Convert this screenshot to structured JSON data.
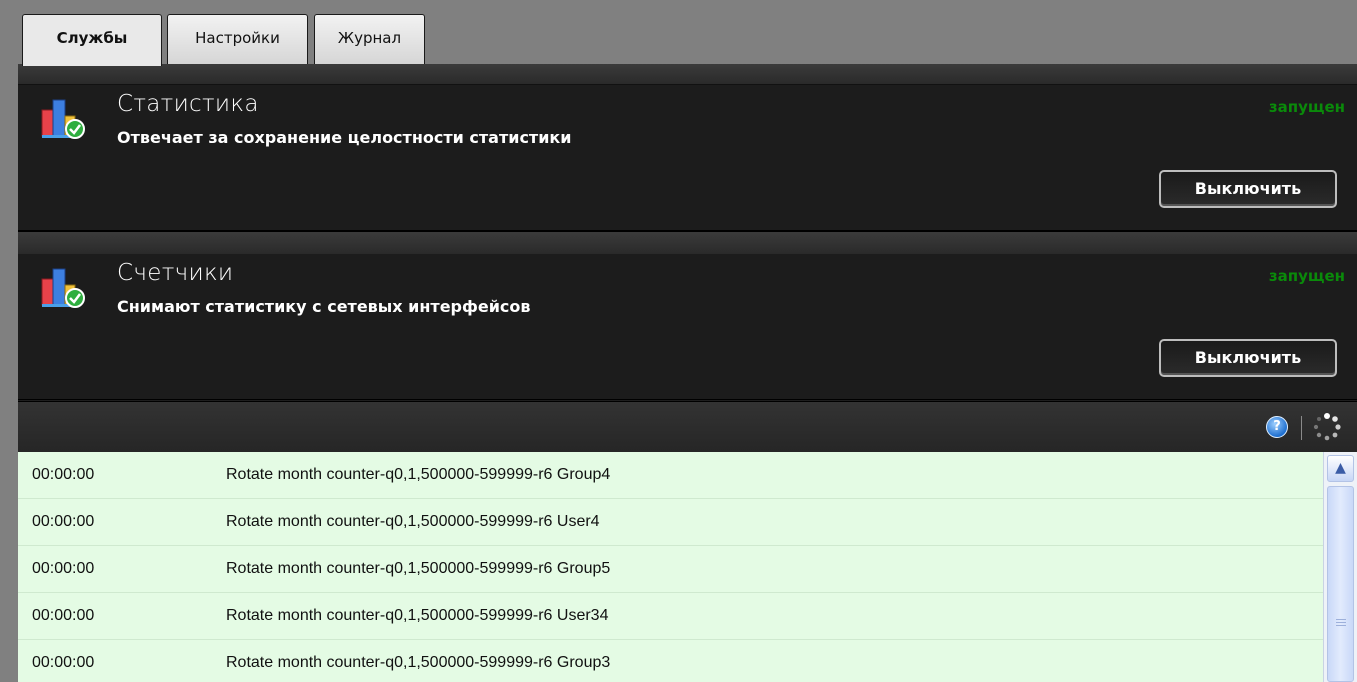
{
  "tabs": [
    {
      "label": "Службы",
      "active": true
    },
    {
      "label": "Настройки",
      "active": false
    },
    {
      "label": "Журнал",
      "active": false
    }
  ],
  "services": [
    {
      "title": "Статистика",
      "description": "Отвечает за сохранение целостности статистики",
      "status": "запущен",
      "button_label": "Выключить",
      "icon": "statistics-service-icon"
    },
    {
      "title": "Счетчики",
      "description": "Снимают статистику с сетевых интерфейсов",
      "status": "запущен",
      "button_label": "Выключить",
      "icon": "counters-service-icon"
    }
  ],
  "log_toolbar": {
    "help_icon": "help-icon",
    "help_glyph": "?",
    "refresh_icon": "refresh-icon"
  },
  "log": {
    "rows": [
      {
        "time": "00:00:00",
        "message": "Rotate month counter-q0,1,500000-599999-r6 Group4"
      },
      {
        "time": "00:00:00",
        "message": "Rotate month counter-q0,1,500000-599999-r6 User4"
      },
      {
        "time": "00:00:00",
        "message": "Rotate month counter-q0,1,500000-599999-r6 Group5"
      },
      {
        "time": "00:00:00",
        "message": "Rotate month counter-q0,1,500000-599999-r6 User34"
      },
      {
        "time": "00:00:00",
        "message": "Rotate month counter-q0,1,500000-599999-r6 Group3"
      }
    ]
  },
  "colors": {
    "status_running": "#0a8a0a",
    "log_background": "#e4fbe4",
    "panel_background": "#1c1c1c"
  }
}
